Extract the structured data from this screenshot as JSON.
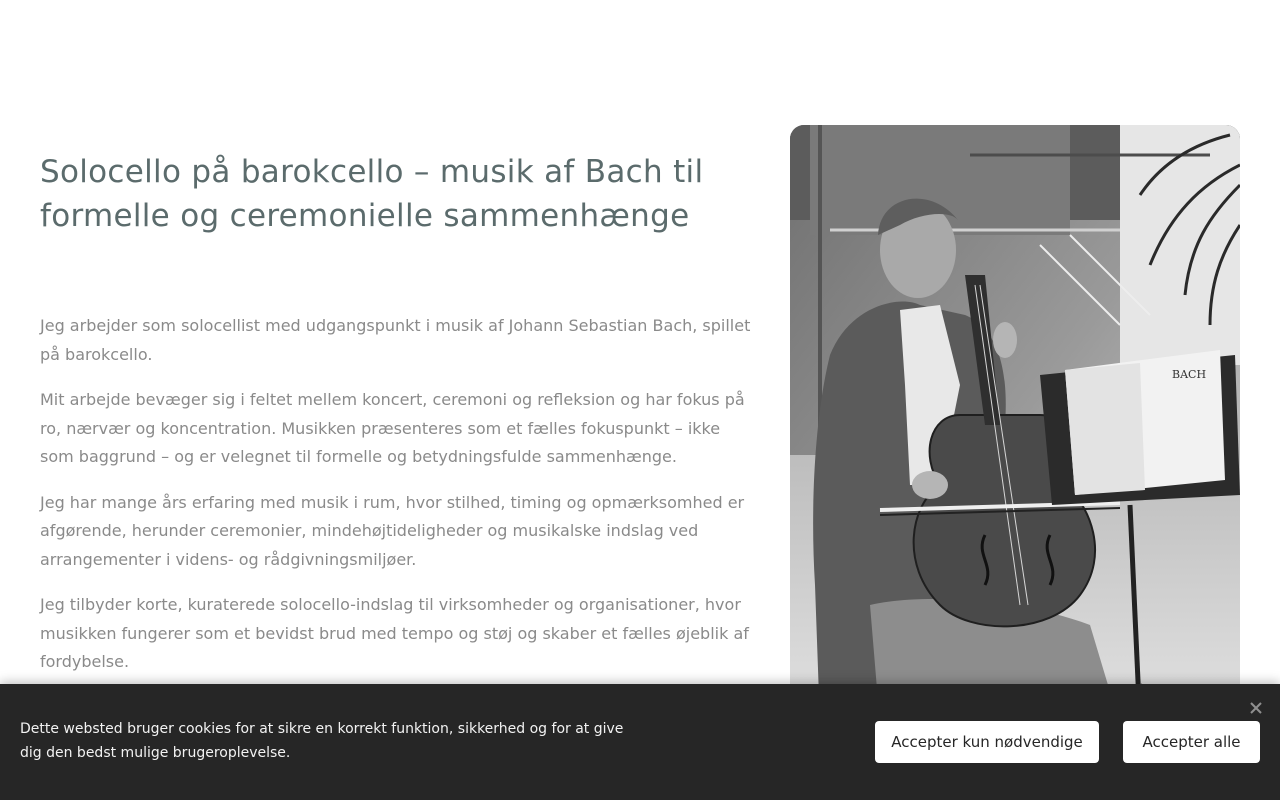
{
  "main": {
    "heading": "Solocello på barokcello – musik af Bach til formelle og ceremonielle sammenhænge",
    "paragraphs": [
      "Jeg arbejder som solocellist med udgangspunkt i musik af Johann Sebastian Bach, spillet på barokcello.",
      "Mit arbejde bevæger sig i feltet mellem koncert, ceremoni og refleksion og har fokus på ro, nærvær og koncentration. Musikken præsenteres som et fælles fokuspunkt – ikke som baggrund – og er velegnet til formelle og betydningsfulde sammenhænge.",
      "Jeg har mange års erfaring med musik i rum, hvor stilhed, timing og opmærksomhed er afgørende, herunder ceremonier, mindehøjtideligheder og musikalske indslag ved arrangementer i videns- og rådgivningsmiljøer.",
      "Jeg tilbyder korte, kuraterede solocello-indslag til virksomheder og organisationer, hvor musikken fungerer som et bevidst brud med tempo og støj og skaber et fælles øjeblik af fordybelse."
    ],
    "photo": {
      "sheet_music_text": "BACH"
    }
  },
  "cookie_banner": {
    "text": "Dette websted bruger cookies for at sikre en korrekt funktion, sikkerhed og for at give dig den bedst mulige brugeroplevelse.",
    "accept_necessary_label": "Accepter kun nødvendige",
    "accept_all_label": "Accepter alle",
    "close_icon": "close-icon"
  },
  "colors": {
    "heading": "#5b6b6c",
    "body_text": "#8a8a8a",
    "banner_bg": "#262626",
    "button_bg": "#ffffff"
  }
}
